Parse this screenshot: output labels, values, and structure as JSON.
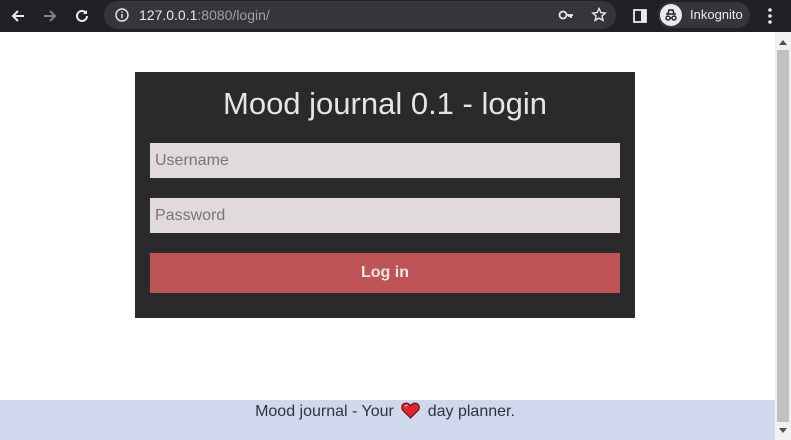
{
  "browser": {
    "url_host": "127.0.0.1",
    "url_rest": ":8080/login/",
    "profile_label": "Inkognito",
    "icons": [
      "back-arrow-icon",
      "forward-arrow-icon",
      "reload-icon",
      "info-icon",
      "key-icon",
      "star-icon",
      "side-panel-icon",
      "incognito-icon",
      "menu-dots-icon"
    ]
  },
  "login": {
    "title": "Mood journal 0.1 - login",
    "username_placeholder": "Username",
    "password_placeholder": "Password",
    "submit_label": "Log in"
  },
  "footer": {
    "text_before": "Mood journal - Your",
    "text_after": "day planner."
  },
  "colors": {
    "card_bg": "#2a292c",
    "field_bg": "#e1dada",
    "button_bg": "#bf5457",
    "footer_bg": "#cfd8ec",
    "heart": "#e0242b"
  }
}
